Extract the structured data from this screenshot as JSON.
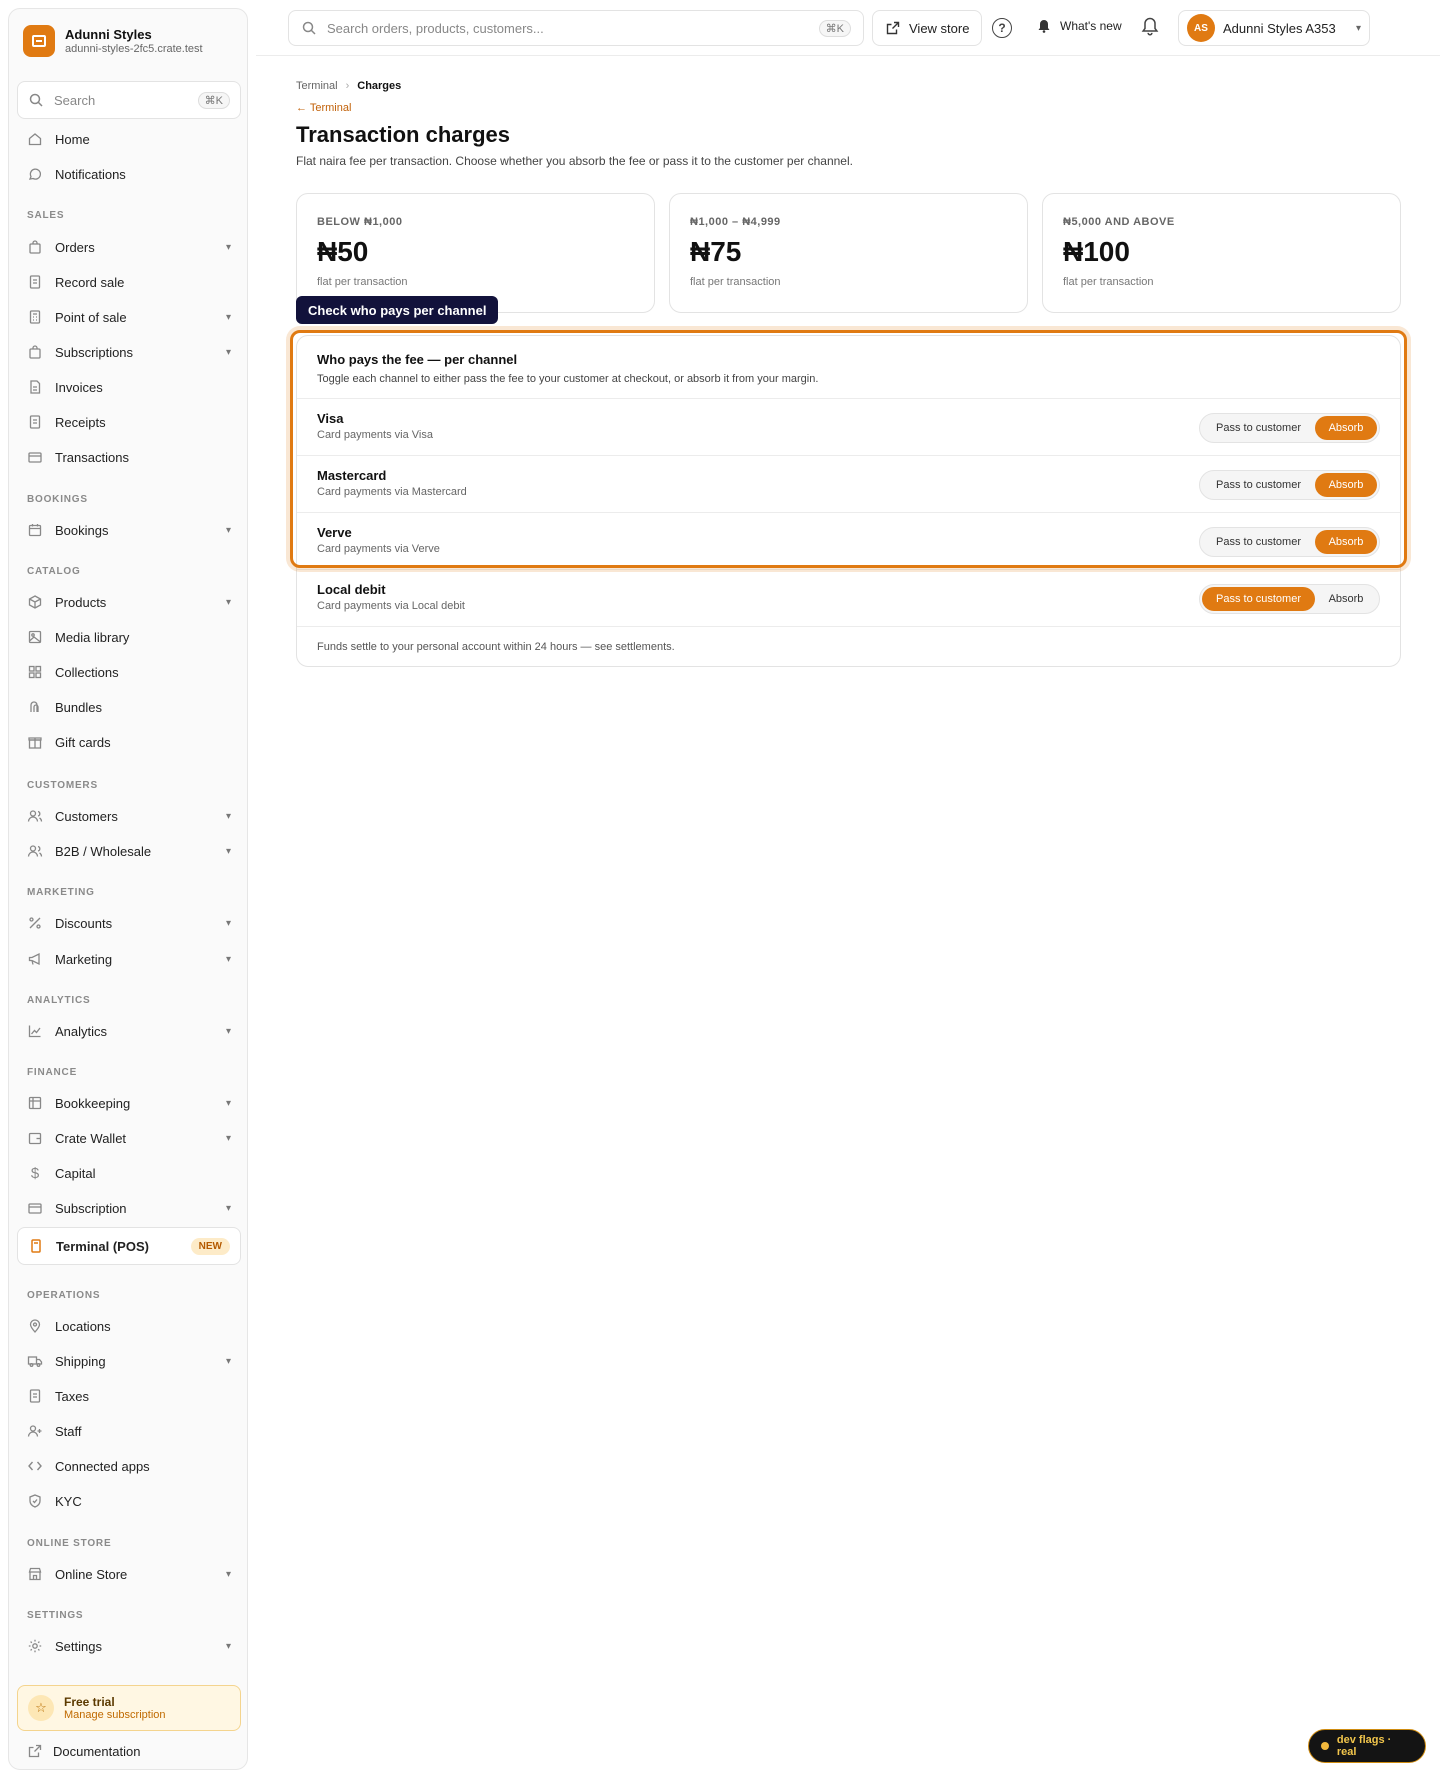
{
  "brand": {
    "name": "Adunni Styles",
    "url": "adunni-styles-2fc5.crate.test"
  },
  "sidebar": {
    "search_placeholder": "Search",
    "search_kbd": "⌘K",
    "sections": {
      "sales": "SALES",
      "bookings": "BOOKINGS",
      "catalog": "CATALOG",
      "customers": "CUSTOMERS",
      "marketing": "MARKETING",
      "analytics": "ANALYTICS",
      "finance": "FINANCE",
      "operations": "OPERATIONS",
      "online_store": "ONLINE STORE",
      "settings": "SETTINGS"
    },
    "items": {
      "home": "Home",
      "notifications": "Notifications",
      "orders": "Orders",
      "record_sale": "Record sale",
      "point_of_sale": "Point of sale",
      "subscriptions": "Subscriptions",
      "invoices": "Invoices",
      "receipts": "Receipts",
      "transactions": "Transactions",
      "bookings": "Bookings",
      "products": "Products",
      "media_library": "Media library",
      "collections": "Collections",
      "bundles": "Bundles",
      "gift_cards": "Gift cards",
      "customers": "Customers",
      "b2b": "B2B / Wholesale",
      "discounts": "Discounts",
      "marketing": "Marketing",
      "analytics": "Analytics",
      "bookkeeping": "Bookkeeping",
      "crate_wallet": "Crate Wallet",
      "capital": "Capital",
      "subscription": "Subscription",
      "terminal": "Terminal (POS)",
      "locations": "Locations",
      "shipping": "Shipping",
      "taxes": "Taxes",
      "staff": "Staff",
      "connected_apps": "Connected apps",
      "kyc": "KYC",
      "online_store": "Online Store",
      "settings": "Settings"
    },
    "terminal_badge": "NEW",
    "trial": {
      "title": "Free trial",
      "link": "Manage subscription"
    },
    "documentation": "Documentation"
  },
  "topbar": {
    "search_placeholder": "Search orders, products, customers...",
    "search_kbd": "⌘K",
    "view_store": "View store",
    "help": "?",
    "whats_new": "What's new",
    "avatar_initials": "AS",
    "user_name": "Adunni Styles A353"
  },
  "breadcrumb": {
    "parent": "Terminal",
    "current": "Charges"
  },
  "back_link": "← Terminal",
  "page": {
    "title": "Transaction charges",
    "subtitle": "Flat naira fee per transaction. Choose whether you absorb the fee or pass it to the customer per channel."
  },
  "tiers": [
    {
      "label": "BELOW ₦1,000",
      "amount": "₦50",
      "note": "flat per transaction"
    },
    {
      "label": "₦1,000 – ₦4,999",
      "amount": "₦75",
      "note": "flat per transaction"
    },
    {
      "label": "₦5,000 AND ABOVE",
      "amount": "₦100",
      "note": "flat per transaction"
    }
  ],
  "tooltip": "Check who pays per channel",
  "fee_panel": {
    "heading": "Who pays the fee — per channel",
    "description": "Toggle each channel to either pass the fee to your customer at checkout, or absorb it from your margin.",
    "option_pass": "Pass to customer",
    "option_absorb": "Absorb",
    "channels": [
      {
        "name": "Visa",
        "desc": "Card payments via Visa",
        "selected": "absorb"
      },
      {
        "name": "Mastercard",
        "desc": "Card payments via Mastercard",
        "selected": "absorb"
      },
      {
        "name": "Verve",
        "desc": "Card payments via Verve",
        "selected": "absorb"
      },
      {
        "name": "Local debit",
        "desc": "Card payments via Local debit",
        "selected": "pass"
      }
    ],
    "footer": "Funds settle to your personal account within 24 hours — see settlements."
  },
  "dev_flags": "dev flags · real",
  "colors": {
    "accent": "#e07a12",
    "tooltip_bg": "#12123b"
  }
}
